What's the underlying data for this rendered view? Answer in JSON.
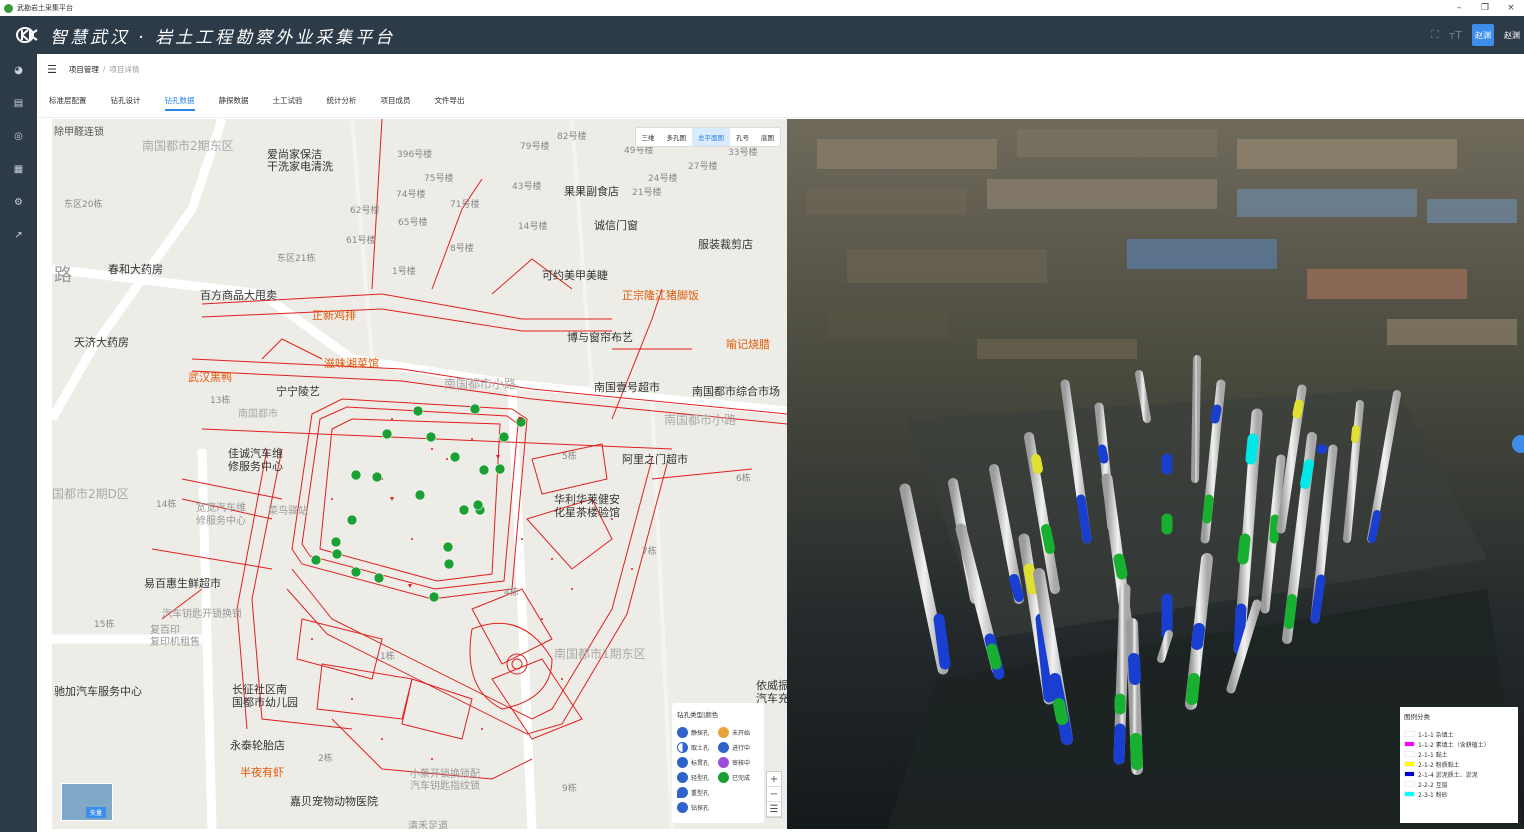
{
  "window": {
    "title": "武勘岩土采集平台",
    "controls": [
      "–",
      "❐",
      "×"
    ]
  },
  "header": {
    "title": "智慧武汉 · 岩土工程勘察外业采集平台",
    "avatar_text": "赵渊",
    "user_name": "赵渊"
  },
  "sidebar": {
    "icons": [
      "dashboard-icon",
      "document-icon",
      "target-icon",
      "grid-icon",
      "settings-icon",
      "export-icon"
    ]
  },
  "breadcrumb": {
    "root": "项目管理",
    "separator": "/",
    "current": "项目详情"
  },
  "tabs": [
    {
      "label": "标准层配置"
    },
    {
      "label": "钻孔设计"
    },
    {
      "label": "钻孔数据"
    },
    {
      "label": "静探数据"
    },
    {
      "label": "土工试验"
    },
    {
      "label": "统计分析"
    },
    {
      "label": "项目成员"
    },
    {
      "label": "文件导出"
    }
  ],
  "active_tab": "钻孔数据",
  "map": {
    "mode_buttons": [
      "三维",
      "多孔图",
      "总平面图",
      "孔号",
      "底图"
    ],
    "active_mode": "总平面图",
    "labels": {
      "l1": "除甲醛连锁",
      "l2": "南国都市2期东区",
      "l3": "爱尚家保洁\n干洗家电清洗",
      "l4": "396号楼",
      "l5": "79号楼",
      "l6": "82号楼",
      "l7": "49号楼",
      "l8": "33号楼",
      "l9": "27号楼",
      "l10": "24号楼",
      "l11": "75号楼",
      "l12": "74号楼",
      "l13": "43号楼",
      "l14": "果果副食店",
      "l15": "21号楼",
      "l16": "东区20栋",
      "l17": "62号楼",
      "l18": "71号楼",
      "l19": "65号楼",
      "l20": "14号楼",
      "l21": "诚信门窗",
      "l22": "61号楼",
      "l23": "8号楼",
      "l24": "服装裁剪店",
      "l25": "东区21栋",
      "l26": "春和大药房",
      "l27": "1号楼",
      "l28": "可约美甲美睫",
      "l29": "百方商品大甩卖",
      "l30": "正宗隆江猪脚饭",
      "l31": "正新鸡排",
      "l32": "博与窗帘布艺",
      "l33": "天济大药房",
      "l34": "喻记烧腊",
      "l35": "滋味湘菜馆",
      "l36": "武汉黑鸭",
      "l37": "宁宁陵艺",
      "l38": "南国都市小路",
      "l39": "南国壹号超市",
      "l40": "南国都市综合市场",
      "l41": "13栋",
      "l42": "南国都市",
      "l43": "南国都市小路",
      "l44": "佳诚汽车维\n修服务中心",
      "l45": "阿里之门超市",
      "l46": "国都市2期D区",
      "l47": "6栋",
      "l48": "14栋",
      "l49": "宽宽汽车维\n修服务中心",
      "l50": "菜鸟驿站",
      "l51": "华利华莱健安\n化星茶楼验馆",
      "l52": "7栋",
      "l53": "易百惠生鲜超市",
      "l54": "汽车钥匙开锁换锁",
      "l55": "15栋",
      "l56": "复百印\n复印机租售",
      "l57": "南国都市1期东区",
      "l58": "驰加汽车服务中心",
      "l59": "长征社区南\n国都市幼儿园",
      "l60": "依威振\n汽车充",
      "l61": "永泰轮胎店",
      "l62": "2栋",
      "l63": "半夜有虾",
      "l64": "小蔡开锁换锁配\n汽车钥匙指纹锁",
      "l65": "9栋",
      "l66": "嘉贝宠物动物医院",
      "l67": "清禾足道",
      "l68": "4栋",
      "l69": "1栋",
      "l70": "5栋",
      "l71": "路"
    },
    "legend": {
      "title": "钻孔类型|颜色",
      "items": [
        {
          "label": "静探孔",
          "color": "#2f63c9"
        },
        {
          "label": "未开始",
          "color": "#e8a33a"
        },
        {
          "label": "取土孔",
          "color": "#2f63c9"
        },
        {
          "label": "进行中",
          "color": "#2f63c9"
        },
        {
          "label": "标贯孔",
          "color": "#2f63c9"
        },
        {
          "label": "审核中",
          "color": "#9a4fdc"
        },
        {
          "label": "轻型孔",
          "color": "#2f63c9"
        },
        {
          "label": "已完成",
          "color": "#1aa033"
        },
        {
          "label": "重型孔",
          "color": "#2f63c9"
        },
        {
          "label": "钻探孔",
          "color": "#2f63c9"
        }
      ]
    },
    "zoom": [
      "+",
      "−",
      "☰"
    ],
    "thumbnail_label": "矢量"
  },
  "legend3d": {
    "title": "图例分类",
    "items": [
      {
        "label": "1-1-1 杂填土",
        "color": "#ffffff"
      },
      {
        "label": "1-1-2 素填土（含耕植土）",
        "color": "#ff00ff"
      },
      {
        "label": "2-1-1 黏土",
        "color": "#ffffff"
      },
      {
        "label": "2-1-2 粉质黏土",
        "color": "#ffff00"
      },
      {
        "label": "2-1-4 淤泥质土、淤泥",
        "color": "#0000cc"
      },
      {
        "label": "2-2-2 互层",
        "color": "#ffffff"
      },
      {
        "label": "2-3-1 粉砂",
        "color": "#00ffff"
      }
    ]
  },
  "colors": {
    "header_bg": "#2d3a48",
    "accent": "#2b84e8",
    "map_red": "#e02020",
    "done_green": "#1aa033"
  }
}
